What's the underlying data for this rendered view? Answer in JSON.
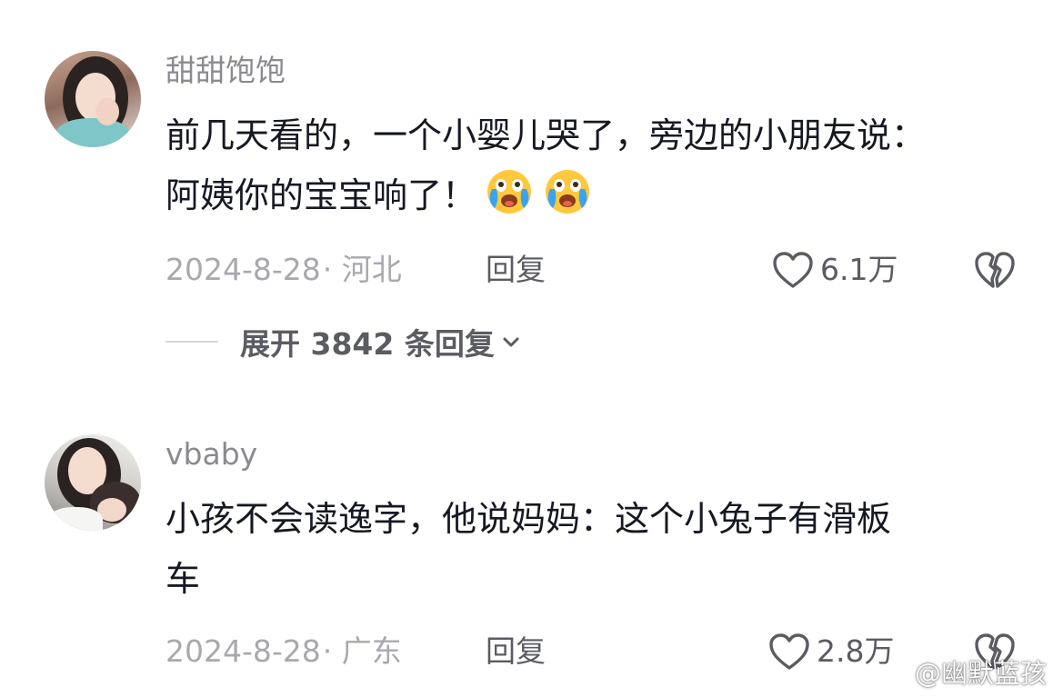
{
  "comments": [
    {
      "username": "甜甜饱饱",
      "text_lines": [
        "前几天看的，一个小婴儿哭了，旁边的小朋友说：",
        "阿姨你的宝宝响了！"
      ],
      "emojis": [
        "crying-laughing-emoji",
        "crying-laughing-emoji"
      ],
      "date": "2024-8-28",
      "region": "· 河北",
      "reply_label": "回复",
      "likes": "6.1万",
      "expand_label": "展开 3842 条回复"
    },
    {
      "username": "vbaby",
      "text_lines": [
        "小孩不会读逸字，他说妈妈：这个小兔子有滑板",
        "车"
      ],
      "date": "2024-8-28",
      "region": "· 广东",
      "reply_label": "回复",
      "likes": "2.8万"
    }
  ],
  "watermark": {
    "text": "@幽默蓝孩",
    "icon": "weibo-icon"
  },
  "colors": {
    "primary_text": "#161823",
    "secondary_text": "#8a8b91",
    "meta_text": "#a8a9ae",
    "action_text": "#5b5c63",
    "emoji_face": "#ffc83d",
    "emoji_tears": "#3aa3f0"
  }
}
